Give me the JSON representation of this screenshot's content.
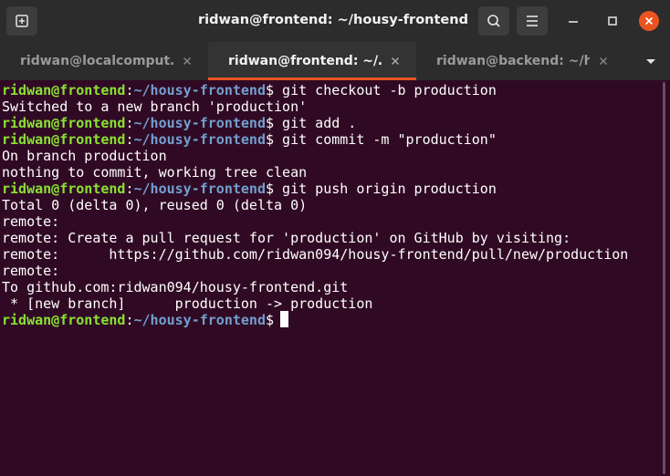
{
  "window": {
    "title": "ridwan@frontend: ~/housy-frontend"
  },
  "titlebar_icons": {
    "new_tab": "new-tab-icon",
    "search": "search-icon",
    "menu": "hamburger-menu-icon",
    "minimize": "minimize-icon",
    "maximize": "maximize-icon",
    "close": "close-icon"
  },
  "tabs": [
    {
      "label": "ridwan@localcomput…",
      "active": false
    },
    {
      "label": "ridwan@frontend: ~/…",
      "active": true
    },
    {
      "label": "ridwan@backend: ~/h…",
      "active": false
    }
  ],
  "colors": {
    "terminal_bg": "#300a24",
    "prompt_user": "#8ae234",
    "prompt_path": "#729fcf",
    "text": "#ffffff",
    "accent": "#e95420",
    "chrome_bg": "#2c2c2c"
  },
  "terminal": {
    "prompt": {
      "user": "ridwan@frontend",
      "sep": ":",
      "path": "~/housy-frontend",
      "symbol": "$"
    },
    "lines": [
      {
        "type": "cmd",
        "text": " git checkout -b production"
      },
      {
        "type": "out",
        "text": "Switched to a new branch 'production'"
      },
      {
        "type": "cmd",
        "text": " git add ."
      },
      {
        "type": "cmd",
        "text": " git commit -m \"production\""
      },
      {
        "type": "out",
        "text": "On branch production"
      },
      {
        "type": "out",
        "text": "nothing to commit, working tree clean"
      },
      {
        "type": "cmd",
        "text": " git push origin production"
      },
      {
        "type": "out",
        "text": "Total 0 (delta 0), reused 0 (delta 0)"
      },
      {
        "type": "out",
        "text": "remote:"
      },
      {
        "type": "out",
        "text": "remote: Create a pull request for 'production' on GitHub by visiting:"
      },
      {
        "type": "out",
        "text": "remote:      https://github.com/ridwan094/housy-frontend/pull/new/production"
      },
      {
        "type": "out",
        "text": "remote:"
      },
      {
        "type": "out",
        "text": "To github.com:ridwan094/housy-frontend.git"
      },
      {
        "type": "out",
        "text": " * [new branch]      production -> production"
      },
      {
        "type": "cmd",
        "text": " "
      }
    ]
  }
}
